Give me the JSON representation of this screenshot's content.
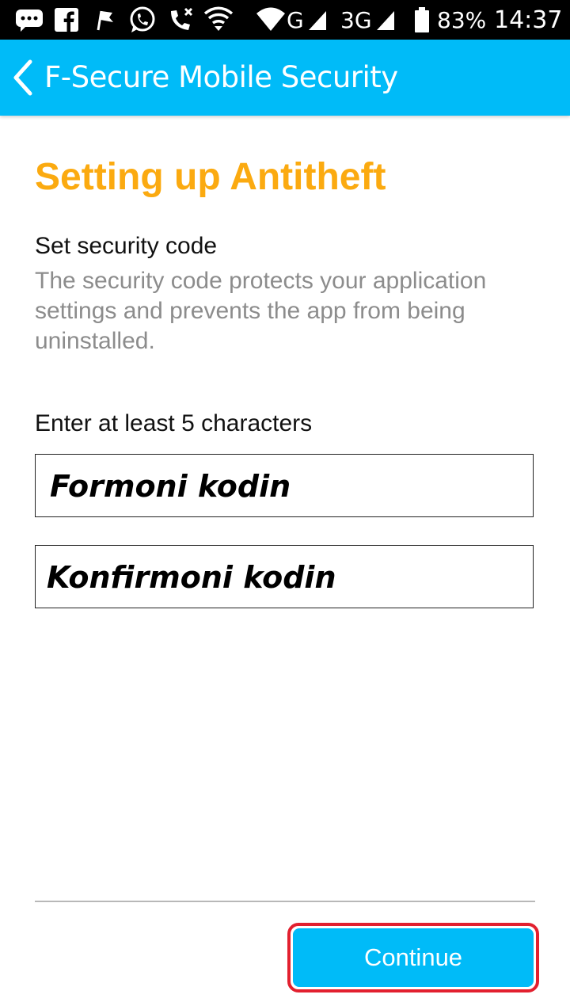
{
  "status_bar": {
    "network_g": "G",
    "network_3g": "3G",
    "battery_percent": "83%",
    "time": "14:37",
    "icons": [
      "message-icon",
      "facebook-icon",
      "flag-icon",
      "whatsapp-icon",
      "missed-call-icon",
      "shield-wifi-icon",
      "wifi-icon",
      "signal-icon",
      "signal-icon",
      "battery-icon"
    ]
  },
  "app_bar": {
    "title": "F-Secure Mobile Security",
    "back_icon": "chevron-left-icon",
    "background_color": "#00bbf8"
  },
  "content": {
    "title": "Setting up Antitheft",
    "section_label": "Set security code",
    "description": "The security code protects your application settings and prevents the app from being uninstalled.",
    "hint": "Enter at least 5 characters",
    "code_field_text": "Formoni kodin",
    "confirm_field_text": "Konfirmoni kodin"
  },
  "footer": {
    "continue_label": "Continue"
  },
  "colors": {
    "accent": "#00bbf8",
    "title": "#fbaa10",
    "highlight": "#e2202f"
  }
}
